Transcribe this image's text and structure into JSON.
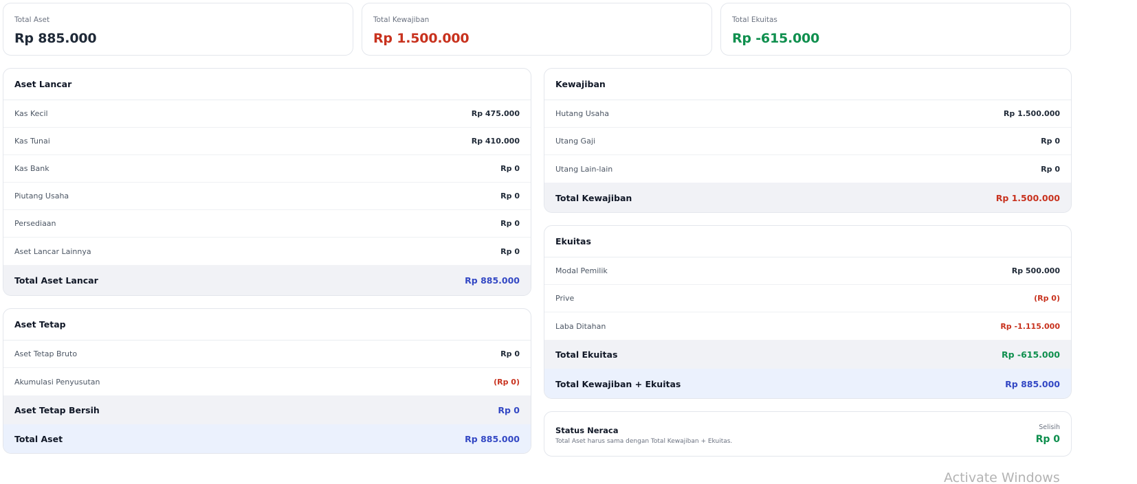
{
  "summary": {
    "total_aset": {
      "label": "Total Aset",
      "value": "Rp 885.000"
    },
    "total_kewajiban": {
      "label": "Total Kewajiban",
      "value": "Rp 1.500.000"
    },
    "total_ekuitas": {
      "label": "Total Ekuitas",
      "value": "Rp -615.000"
    }
  },
  "aset_lancar": {
    "title": "Aset Lancar",
    "rows": [
      {
        "label": "Kas Kecil",
        "value": "Rp 475.000"
      },
      {
        "label": "Kas Tunai",
        "value": "Rp 410.000"
      },
      {
        "label": "Kas Bank",
        "value": "Rp 0"
      },
      {
        "label": "Piutang Usaha",
        "value": "Rp 0"
      },
      {
        "label": "Persediaan",
        "value": "Rp 0"
      },
      {
        "label": "Aset Lancar Lainnya",
        "value": "Rp 0"
      }
    ],
    "total": {
      "label": "Total Aset Lancar",
      "value": "Rp 885.000"
    }
  },
  "aset_tetap": {
    "title": "Aset Tetap",
    "rows": [
      {
        "label": "Aset Tetap Bruto",
        "value": "Rp 0"
      },
      {
        "label": "Akumulasi Penyusutan",
        "value": "(Rp 0)"
      }
    ],
    "bersih": {
      "label": "Aset Tetap Bersih",
      "value": "Rp 0"
    },
    "total": {
      "label": "Total Aset",
      "value": "Rp 885.000"
    }
  },
  "kewajiban": {
    "title": "Kewajiban",
    "rows": [
      {
        "label": "Hutang Usaha",
        "value": "Rp 1.500.000"
      },
      {
        "label": "Utang Gaji",
        "value": "Rp 0"
      },
      {
        "label": "Utang Lain-lain",
        "value": "Rp 0"
      }
    ],
    "total": {
      "label": "Total Kewajiban",
      "value": "Rp 1.500.000"
    }
  },
  "ekuitas": {
    "title": "Ekuitas",
    "rows": [
      {
        "label": "Modal Pemilik",
        "value": "Rp 500.000"
      },
      {
        "label": "Prive",
        "value": "(Rp 0)"
      },
      {
        "label": "Laba Ditahan",
        "value": "Rp -1.115.000"
      }
    ],
    "total": {
      "label": "Total Ekuitas",
      "value": "Rp -615.000"
    },
    "grand_total": {
      "label": "Total Kewajiban + Ekuitas",
      "value": "Rp 885.000"
    }
  },
  "status": {
    "title": "Status Neraca",
    "description": "Total Aset harus sama dengan Total Kewajiban + Ekuitas.",
    "selisih_label": "Selisih",
    "selisih_value": "Rp 0"
  },
  "watermark": "Activate Windows",
  "colors": {
    "negative": "#c8321e",
    "positive": "#0f8f4e",
    "accent": "#3348c4",
    "total_row_bg": "#f1f2f6",
    "grand_total_bg": "#ebf1fd"
  }
}
